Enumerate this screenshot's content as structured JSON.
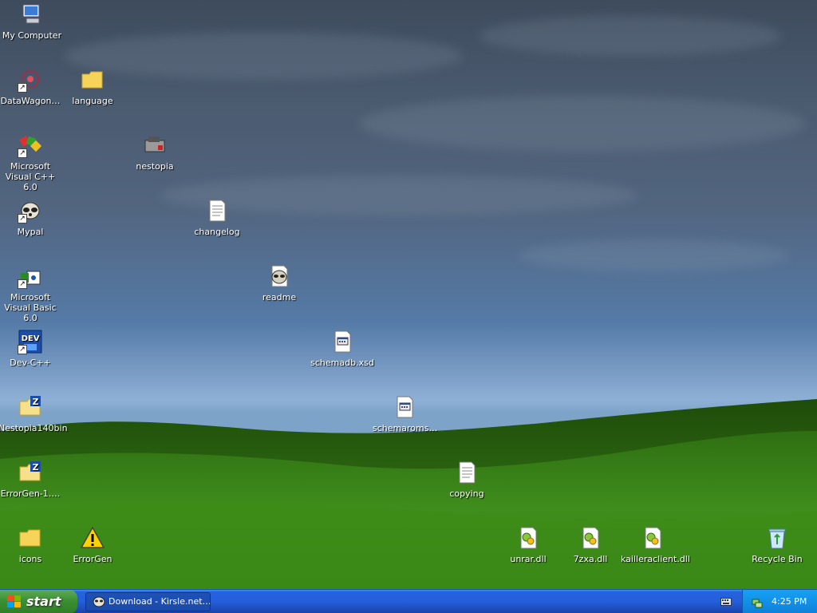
{
  "desktop": {
    "icons": [
      {
        "id": "my-computer",
        "label": "My Computer",
        "icon": "computer-icon",
        "shortcut": false
      },
      {
        "id": "datawagon",
        "label": "DataWagon…",
        "icon": "datawagon-icon",
        "shortcut": true
      },
      {
        "id": "language",
        "label": "language",
        "icon": "folder-icon",
        "shortcut": false
      },
      {
        "id": "msvc",
        "label": "Microsoft Visual C++ 6.0",
        "icon": "visual-cpp-icon",
        "shortcut": true
      },
      {
        "id": "nestopia",
        "label": "nestopia",
        "icon": "nestopia-icon",
        "shortcut": false
      },
      {
        "id": "mypal",
        "label": "Mypal",
        "icon": "mypal-icon",
        "shortcut": true
      },
      {
        "id": "changelog",
        "label": "changelog",
        "icon": "text-file-icon",
        "shortcut": false
      },
      {
        "id": "msvb",
        "label": "Microsoft Visual Basic 6.0",
        "icon": "visual-basic-icon",
        "shortcut": true
      },
      {
        "id": "readme",
        "label": "readme",
        "icon": "mypal-document-icon",
        "shortcut": false
      },
      {
        "id": "devcpp",
        "label": "Dev-C++",
        "icon": "dev-cpp-icon",
        "shortcut": true
      },
      {
        "id": "schemadb",
        "label": "schemadb.xsd",
        "icon": "xsd-file-icon",
        "shortcut": false
      },
      {
        "id": "nestopia140bin",
        "label": "Nestopia140bin",
        "icon": "zip-folder-icon",
        "shortcut": false
      },
      {
        "id": "schemaroms",
        "label": "schemaroms…",
        "icon": "xsd-file-icon",
        "shortcut": false
      },
      {
        "id": "errorgen-zip",
        "label": "ErrorGen-1….",
        "icon": "zip-folder-icon",
        "shortcut": false
      },
      {
        "id": "copying",
        "label": "copying",
        "icon": "text-file-icon",
        "shortcut": false
      },
      {
        "id": "icons",
        "label": "icons",
        "icon": "folder-icon",
        "shortcut": false
      },
      {
        "id": "errorgen",
        "label": "ErrorGen",
        "icon": "warning-icon",
        "shortcut": false
      },
      {
        "id": "unrar",
        "label": "unrar.dll",
        "icon": "dll-file-icon",
        "shortcut": false
      },
      {
        "id": "7zxa",
        "label": "7zxa.dll",
        "icon": "dll-file-icon",
        "shortcut": false
      },
      {
        "id": "kailleraclient",
        "label": "kailleraclient.dll",
        "icon": "dll-file-icon",
        "shortcut": false
      },
      {
        "id": "recycle-bin",
        "label": "Recycle Bin",
        "icon": "recycle-bin-icon",
        "shortcut": false
      }
    ]
  },
  "taskbar": {
    "start_label": "start",
    "task_label": "Download - Kirsle.net…",
    "clock": "4:25 PM"
  },
  "colors": {
    "taskbar_blue": "#245edb",
    "start_green": "#3c8f32",
    "tray_blue": "#1290e8"
  }
}
